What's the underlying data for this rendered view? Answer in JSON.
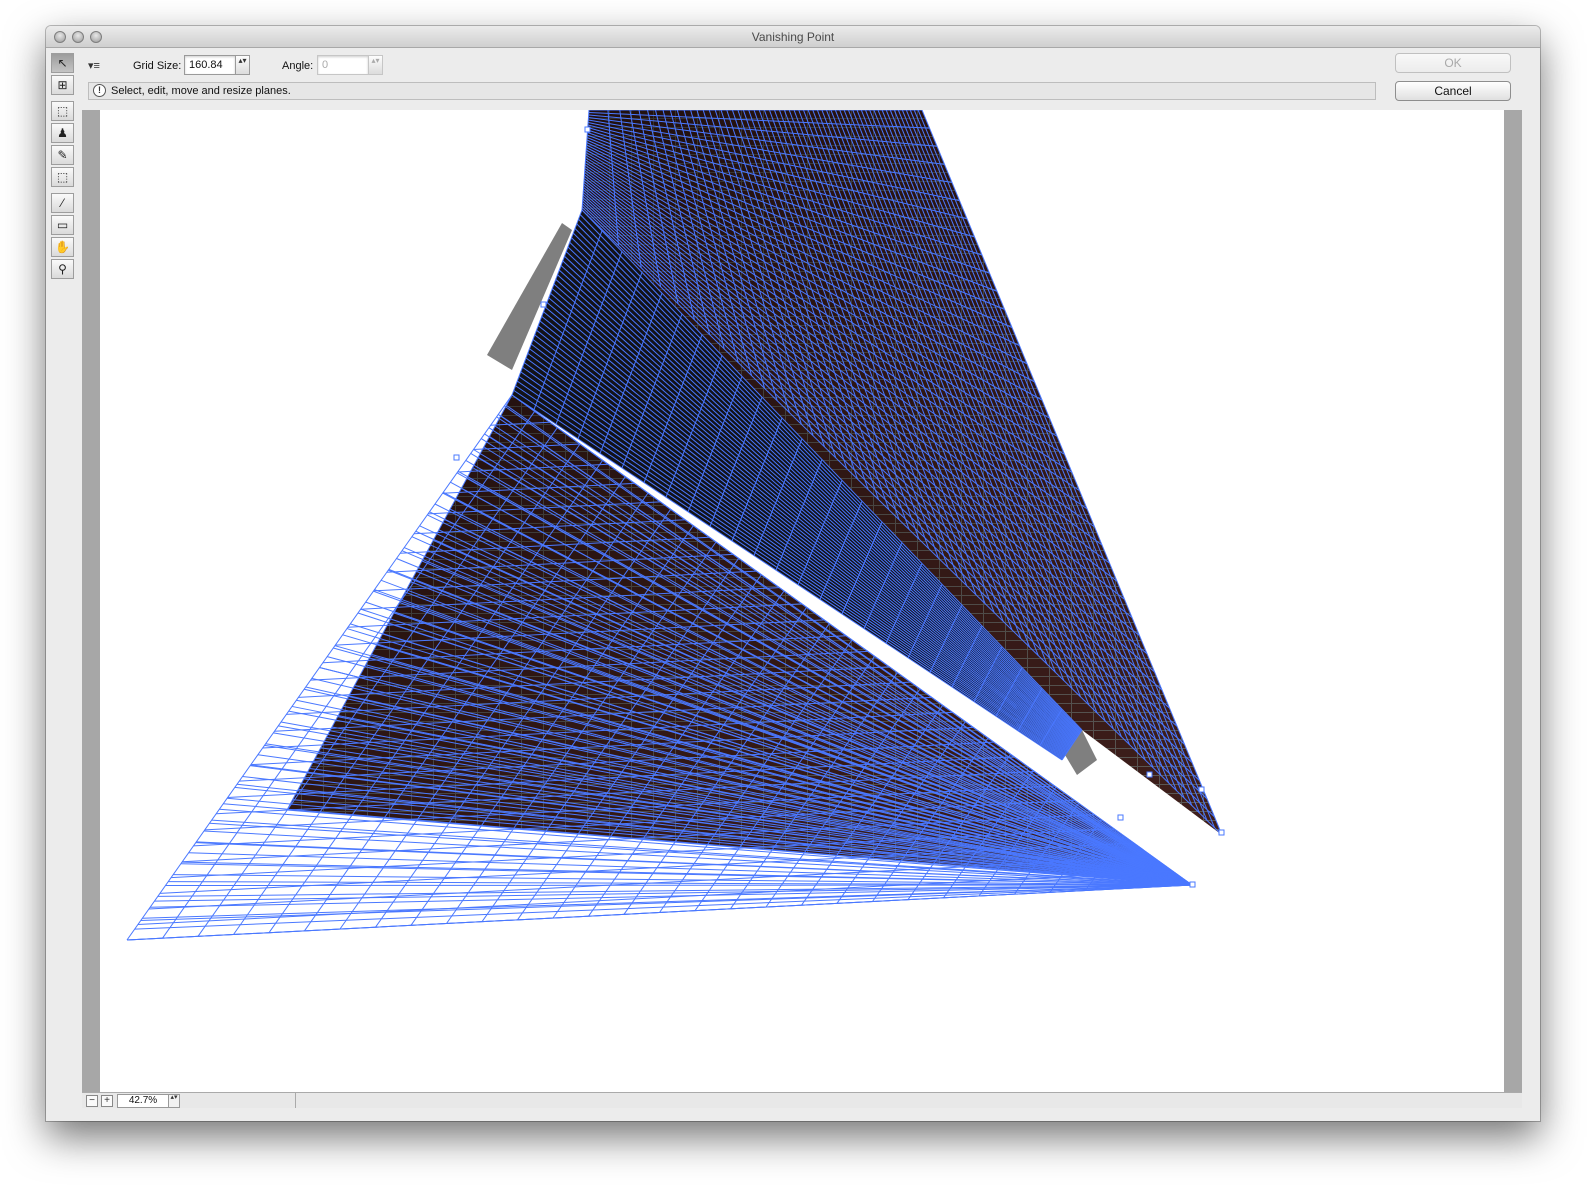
{
  "window": {
    "title": "Vanishing Point"
  },
  "toolbar": {
    "tool_options_icon": "▾≡",
    "grid_size_label": "Grid Size:",
    "grid_size_value": "160.84",
    "angle_label": "Angle:",
    "angle_value": "0",
    "stepper_glyph": "▴▾"
  },
  "buttons": {
    "ok_label": "OK",
    "cancel_label": "Cancel"
  },
  "status": {
    "icon_glyph": "!",
    "message": "Select, edit, move and resize planes."
  },
  "tools": [
    {
      "name": "edit-plane-tool",
      "glyph": "↖",
      "active": true
    },
    {
      "name": "create-plane-tool",
      "glyph": "⊞",
      "active": false
    },
    {
      "name": "marquee-tool",
      "glyph": "⬚",
      "active": false
    },
    {
      "name": "stamp-tool",
      "glyph": "♟",
      "active": false
    },
    {
      "name": "brush-tool",
      "glyph": "✎",
      "active": false
    },
    {
      "name": "transform-tool",
      "glyph": "⬚",
      "active": false
    },
    {
      "name": "eyedropper-tool",
      "glyph": "⁄",
      "active": false
    },
    {
      "name": "measure-tool",
      "glyph": "▭",
      "active": false
    },
    {
      "name": "hand-tool",
      "glyph": "✋",
      "active": false
    },
    {
      "name": "zoom-tool",
      "glyph": "⚲",
      "active": false
    }
  ],
  "zoom": {
    "minus": "−",
    "plus": "+",
    "value": "42.7%"
  },
  "colors": {
    "grid_line": "#4a78ff",
    "canvas_bg": "#a7a7a7",
    "document_bg": "#ffffff",
    "wall_dark": "#1c1414"
  }
}
